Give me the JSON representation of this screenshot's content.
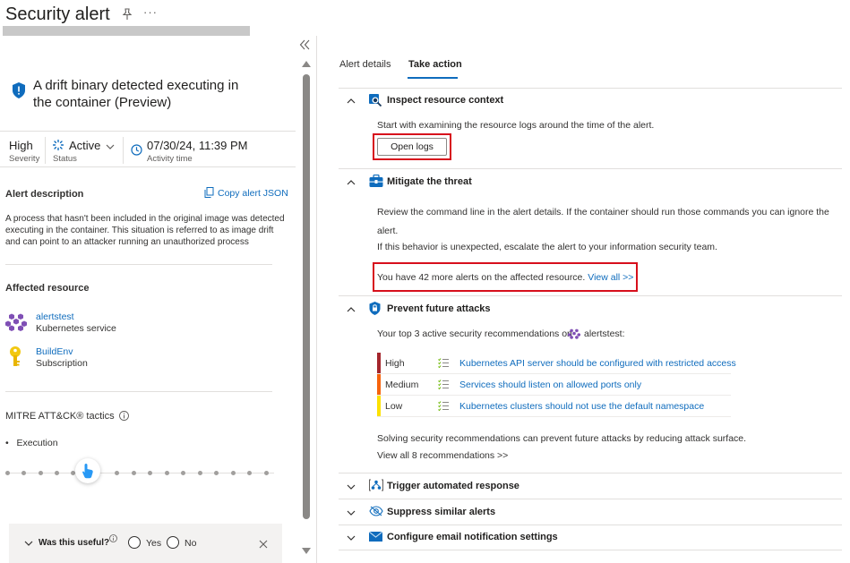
{
  "header": {
    "title": "Security alert",
    "more_label": "···"
  },
  "alert": {
    "title": "A drift binary detected executing in the container (Preview)",
    "severity": {
      "value": "High",
      "label": "Severity"
    },
    "status": {
      "value": "Active",
      "label": "Status"
    },
    "activity": {
      "value": "07/30/24, 11:39 PM",
      "label": "Activity time"
    },
    "description_heading": "Alert description",
    "copy_json": "Copy alert JSON",
    "description": "A process that hasn't been included in the original image was detected executing in the container. This situation is referred to as image drift and can point to an attacker running an unauthorized process",
    "affected_heading": "Affected resource",
    "resources": [
      {
        "name": "alertstest",
        "type": "Kubernetes service",
        "icon": "kubernetes-icon"
      },
      {
        "name": "BuildEnv",
        "type": "Subscription",
        "icon": "key-icon"
      }
    ],
    "mitre_heading": "MITRE ATT&CK® tactics",
    "mitre_items": [
      "Execution"
    ]
  },
  "feedback": {
    "question": "Was this useful?",
    "yes": "Yes",
    "no": "No"
  },
  "tabs": [
    {
      "label": "Alert details",
      "active": false
    },
    {
      "label": "Take action",
      "active": true
    }
  ],
  "sections": {
    "inspect": {
      "title": "Inspect resource context",
      "text": "Start with examining the resource logs around the time of the alert.",
      "button": "Open logs"
    },
    "mitigate": {
      "title": "Mitigate the threat",
      "text1": "Review the command line in the alert details. If the container should run those commands you can ignore the alert.",
      "text2": "If this behavior is unexpected, escalate the alert to your information security team.",
      "more_alerts": "You have 42 more alerts on the affected resource.",
      "view_all": "View all >>"
    },
    "prevent": {
      "title": "Prevent future attacks",
      "intro": "Your top 3 active security recommendations on",
      "resource": "alertstest:",
      "recommendations": [
        {
          "severity": "High",
          "color": "#a4262c",
          "title": "Kubernetes API server should be configured with restricted access"
        },
        {
          "severity": "Medium",
          "color": "#f7630c",
          "title": "Services should listen on allowed ports only"
        },
        {
          "severity": "Low",
          "color": "#fce100",
          "title": "Kubernetes clusters should not use the default namespace"
        }
      ],
      "footer": "Solving security recommendations can prevent future attacks by reducing attack surface.",
      "view_all": "View all 8 recommendations >>"
    },
    "trigger": {
      "title": "Trigger automated response"
    },
    "suppress": {
      "title": "Suppress similar alerts"
    },
    "email": {
      "title": "Configure email notification settings"
    }
  },
  "colors": {
    "accent": "#0f6cbd",
    "highlight_box": "#d70f1c"
  }
}
